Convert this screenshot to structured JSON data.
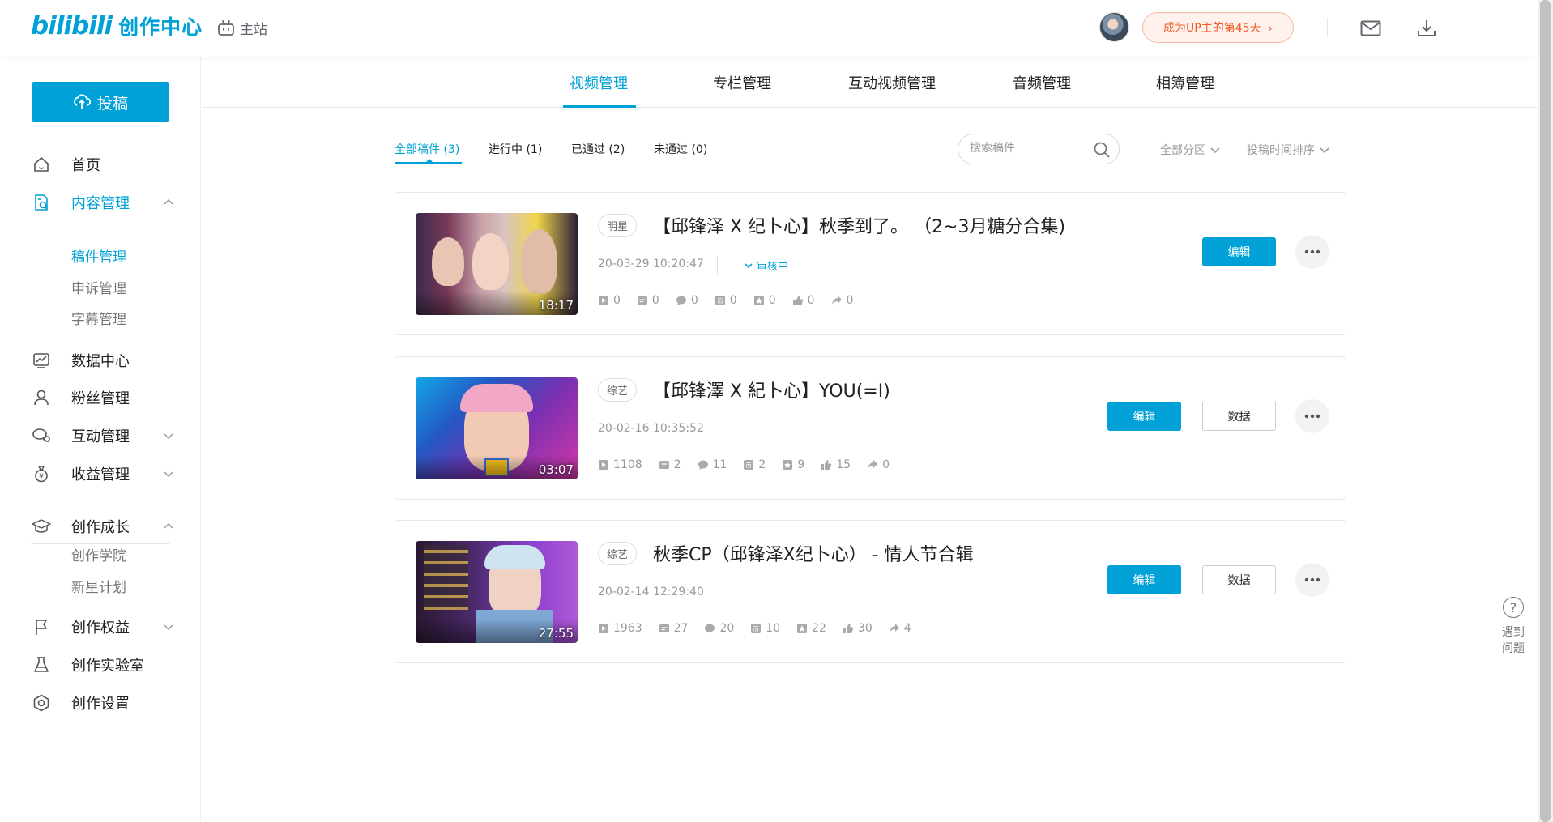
{
  "header": {
    "logo_text": "bilibili",
    "logo_suffix": "创作中心",
    "home_link": "主站",
    "up_badge": "成为UP主的第45天",
    "up_badge_chevron": "›"
  },
  "sidebar": {
    "upload_label": "投稿",
    "items": [
      {
        "label": "首页",
        "icon": "home-icon"
      },
      {
        "label": "内容管理",
        "icon": "content-icon"
      },
      {
        "label": "数据中心",
        "icon": "chart-icon"
      },
      {
        "label": "粉丝管理",
        "icon": "user-icon"
      },
      {
        "label": "互动管理",
        "icon": "chat-icon"
      },
      {
        "label": "收益管理",
        "icon": "money-bag-icon"
      },
      {
        "label": "创作成长",
        "icon": "graduation-cap-icon"
      },
      {
        "label": "创作权益",
        "icon": "flag-icon"
      },
      {
        "label": "创作实验室",
        "icon": "flask-icon"
      },
      {
        "label": "创作设置",
        "icon": "settings-icon"
      }
    ],
    "content_sub": [
      "稿件管理",
      "申诉管理",
      "字幕管理"
    ],
    "growth_sub": [
      "创作学院",
      "新星计划"
    ]
  },
  "tabs": [
    "视频管理",
    "专栏管理",
    "互动视频管理",
    "音频管理",
    "相簿管理"
  ],
  "filters": [
    "全部稿件 (3)",
    "进行中 (1)",
    "已通过 (2)",
    "未通过 (0)"
  ],
  "search": {
    "placeholder": "搜索稿件"
  },
  "dropdowns": {
    "zone": "全部分区",
    "sort": "投稿时间排序"
  },
  "videos": [
    {
      "duration": "18:17",
      "tag": "明星",
      "title": "【邱锋泽 X 纪卜心】秋季到了。 （2~3月糖分合集)",
      "time": "20-03-29 10:20:47",
      "status": "审核中",
      "stats": [
        "0",
        "0",
        "0",
        "0",
        "0",
        "0",
        "0"
      ],
      "edit_label": "编辑"
    },
    {
      "duration": "03:07",
      "tag": "综艺",
      "title": "【邱锋澤 X 紀卜心】YOU(=I)",
      "time": "20-02-16 10:35:52",
      "stats": [
        "1108",
        "2",
        "11",
        "2",
        "9",
        "15",
        "0"
      ],
      "edit_label": "编辑",
      "data_label": "数据"
    },
    {
      "duration": "27:55",
      "tag": "综艺",
      "title": "秋季CP（邱锋泽X纪卜心） - 情人节合辑",
      "time": "20-02-14 12:29:40",
      "stats": [
        "1963",
        "27",
        "20",
        "10",
        "22",
        "30",
        "4"
      ],
      "edit_label": "编辑",
      "data_label": "数据"
    }
  ],
  "help": {
    "icon": "?",
    "label": "遇到问题"
  },
  "colors": {
    "accent": "#00a1d6",
    "badge_text": "#f25d2a",
    "badge_bg": "#fff1ec"
  }
}
